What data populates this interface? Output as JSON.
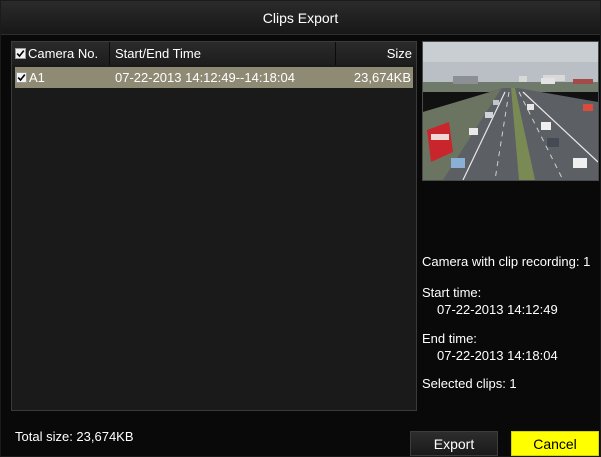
{
  "window": {
    "title": "Clips Export"
  },
  "table": {
    "columns": {
      "camera": "Camera No.",
      "time": "Start/End Time",
      "size": "Size"
    },
    "header_checked": true,
    "rows": [
      {
        "checked": true,
        "camera": "A1",
        "time": "07-22-2013 14:12:49--14:18:04",
        "size": "23,674KB"
      }
    ]
  },
  "preview": {
    "description_icon": "video-preview-thumbnail"
  },
  "info": {
    "camera_with_clip": "Camera with clip recording: 1",
    "start_time_label": "Start time:",
    "start_time_value": "07-22-2013 14:12:49",
    "end_time_label": "End time:",
    "end_time_value": "07-22-2013 14:18:04",
    "selected_clips": "Selected clips: 1"
  },
  "footer": {
    "total_size": "Total size: 23,674KB",
    "export_label": "Export",
    "cancel_label": "Cancel"
  },
  "colors": {
    "selected_row": "#8f8a74",
    "cancel_button": "#ffff00",
    "background": "#090909"
  }
}
